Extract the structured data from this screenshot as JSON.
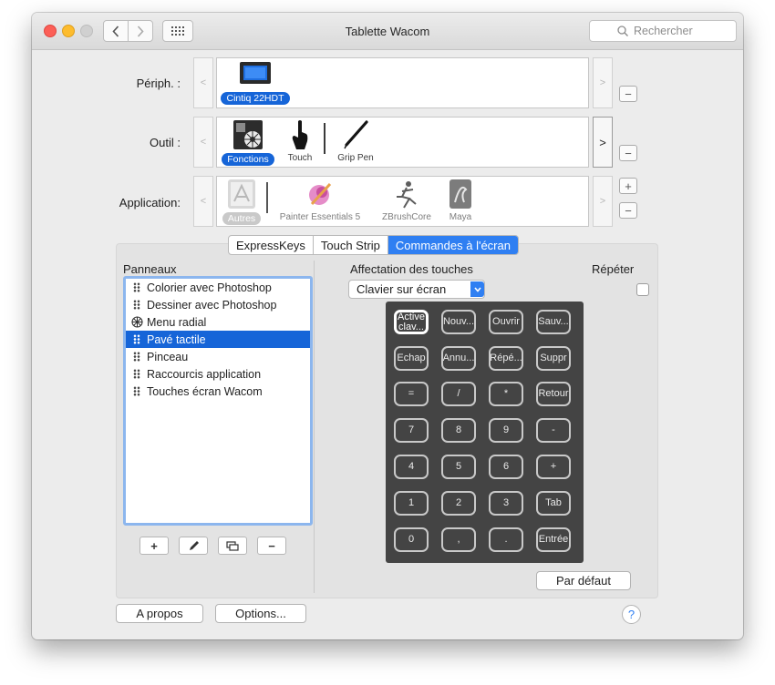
{
  "window": {
    "title": "Tablette Wacom"
  },
  "search": {
    "placeholder": "Rechercher"
  },
  "periph": {
    "label": "Périph. :",
    "devices": [
      {
        "name": "Cintiq 22HDT"
      }
    ]
  },
  "tool": {
    "label": "Outil :",
    "items": [
      {
        "name": "Fonctions"
      },
      {
        "name": "Touch"
      },
      {
        "name": "Grip Pen"
      }
    ]
  },
  "application": {
    "label": "Application:",
    "items": [
      {
        "name": "Autres"
      },
      {
        "name": "Painter Essentials 5"
      },
      {
        "name": "ZBrushCore"
      },
      {
        "name": "Maya"
      }
    ]
  },
  "tabs": [
    "ExpressKeys",
    "Touch Strip",
    "Commandes à l'écran"
  ],
  "panels": {
    "label": "Panneaux",
    "items": [
      {
        "label": "Colorier avec Photoshop",
        "icon": "grip-icon"
      },
      {
        "label": "Dessiner avec Photoshop",
        "icon": "grip-icon"
      },
      {
        "label": "Menu radial",
        "icon": "radial-menu-icon"
      },
      {
        "label": "Pavé tactile",
        "icon": "grip-icon",
        "selected": true
      },
      {
        "label": "Pinceau",
        "icon": "grip-icon"
      },
      {
        "label": "Raccourcis application",
        "icon": "grip-icon"
      },
      {
        "label": "Touches écran Wacom",
        "icon": "grip-icon"
      }
    ]
  },
  "assignment": {
    "label": "Affectation des touches",
    "select_value": "Clavier sur écran",
    "repeat_label": "Répéter"
  },
  "keys": [
    [
      "Active clav...",
      "Nouv...",
      "Ouvrir",
      "Sauv..."
    ],
    [
      "Echap",
      "Annu...",
      "Répé...",
      "Suppr"
    ],
    [
      "=",
      "/",
      "*",
      "Retour"
    ],
    [
      "7",
      "8",
      "9",
      "-"
    ],
    [
      "4",
      "5",
      "6",
      "+"
    ],
    [
      "1",
      "2",
      "3",
      "Tab"
    ],
    [
      "0",
      ",",
      ".",
      "Entrée"
    ]
  ],
  "buttons": {
    "default": "Par défaut",
    "about": "A propos",
    "options": "Options...",
    "help": "?"
  }
}
